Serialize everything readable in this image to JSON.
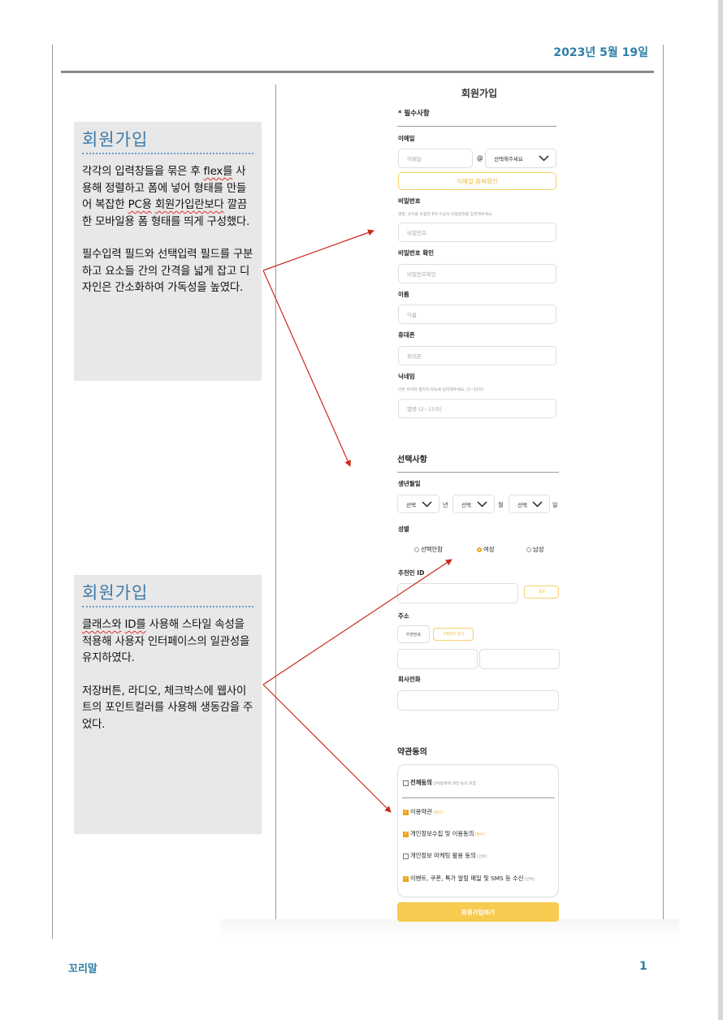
{
  "header": {
    "date": "2023년 5월 19일"
  },
  "footer": {
    "text": "꼬리말",
    "page_number": "1"
  },
  "notes": [
    {
      "title": "회원가입",
      "paragraphs": [
        [
          "각각의 입력창들을 묶은 후 ",
          "flex를",
          " 사용해 정렬하고 폼에 넣어 형태를 만들어 복잡한 ",
          "PC용",
          " ",
          "회원가입란보다",
          " 깔끔한 모바일용 폼 형태를 띄게 구성했다."
        ],
        [
          "필수입력 필드와 선택입력 필드를 구분하고 요소들 간의 간격을 넓게 잡고 디자인은 간소화하여 가독성을 높였다."
        ]
      ]
    },
    {
      "title": "회원가입",
      "paragraphs": [
        [
          "",
          "클래스와",
          " ",
          "ID를",
          " 사용해 스타일 속성을 적용해 사용자 인터페이스의 일관성을 유지하였다."
        ],
        [
          "저장버튼, 라디오, 체크박스에 웹사이트의 포인트컬러를 사용해 생동감을 주었다."
        ]
      ]
    }
  ],
  "form": {
    "title": "회원가입",
    "required_section": "* 필수사항",
    "email": {
      "label": "이메일",
      "placeholder": "이메일",
      "at": "@",
      "domain_select": "선택해주세요",
      "dup_button": "이메일 중복확인"
    },
    "password": {
      "label": "비밀번호",
      "hint": "영문, 숫자를 포함한 8자 이상의 비밀번호를 입력해주세요.",
      "placeholder": "비밀번호"
    },
    "password_confirm": {
      "label": "비밀번호 확인",
      "placeholder": "비밀번호확인"
    },
    "name": {
      "label": "이름",
      "placeholder": "이름"
    },
    "phone": {
      "label": "휴대폰",
      "placeholder": "휴대폰"
    },
    "nickname": {
      "label": "닉네임",
      "hint": "다른 유저와 겹치지 않도록 입력해주세요. (2~15자)",
      "placeholder": "별명 (2~15자)"
    },
    "optional_section": "선택사항",
    "birth": {
      "label": "생년월일",
      "year_select": "선택",
      "year_unit": "년",
      "month_select": "선택",
      "month_unit": "월",
      "day_select": "선택",
      "day_unit": "일"
    },
    "gender": {
      "label": "성별",
      "options": [
        "선택안함",
        "여성",
        "남성"
      ],
      "selected": "여성"
    },
    "referrer": {
      "label": "추천인 ID",
      "search_button": "검색"
    },
    "address": {
      "label": "주소",
      "zip_label": "우편번호",
      "zip_button": "우편번호 찾기"
    },
    "company_phone": {
      "label": "회사전화"
    },
    "terms_section": "약관동의",
    "terms": {
      "all": {
        "label": "전체동의",
        "sub": "선택항목에 대한 동의 포함",
        "checked": false
      },
      "items": [
        {
          "label": "이용약관",
          "tag": "(필수)",
          "checked": true,
          "tag_style": "required"
        },
        {
          "label": "개인정보수집 및 이용동의",
          "tag": "(필수)",
          "checked": true,
          "tag_style": "required"
        },
        {
          "label": "개인정보 마케팅 활용 동의",
          "tag": "(선택)",
          "checked": false,
          "tag_style": "optional"
        },
        {
          "label": "이벤트, 쿠폰, 특가 알림 메일 및 SMS 등 수신",
          "tag": "(선택)",
          "checked": true,
          "tag_style": "optional"
        }
      ]
    },
    "submit": "회원가입하기"
  },
  "colors": {
    "accent": "#f0a21b",
    "header_blue": "#2f7fa5",
    "arrow_red": "#cc2a1d",
    "note_bg": "#e8e8e8"
  }
}
